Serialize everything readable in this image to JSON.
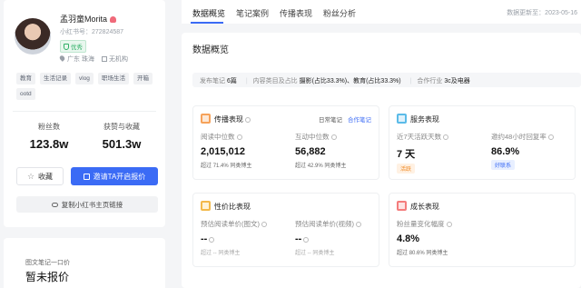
{
  "profile": {
    "name": "孟羽童Morita",
    "id_text": "小红书号：272824587",
    "badge": "优秀",
    "location": "广东 珠海",
    "org": "无机构",
    "tags": [
      "教育",
      "生活记录",
      "vlog",
      "职场生活",
      "开箱",
      "ootd"
    ],
    "stats": [
      {
        "label": "粉丝数",
        "value": "123.8w"
      },
      {
        "label": "获赞与收藏",
        "value": "501.3w"
      }
    ],
    "fav_button": "收藏",
    "quote_button": "邀请TA开启报价",
    "copy_button": "复制小红书主页链接"
  },
  "price": {
    "subtitle": "图文笔记一口价",
    "value": "暂未报价"
  },
  "tabs": [
    "数据概览",
    "笔记案例",
    "传播表现",
    "粉丝分析"
  ],
  "update_text": "数据更新至：2023-05-16",
  "overview": {
    "title": "数据概览",
    "info": {
      "posts_label": "发布笔记",
      "posts_value": "6篇",
      "category_label": "内容类目及占比",
      "category_value": "摄影(占比33.3%)、教育(占比33.3%)",
      "industry_label": "合作行业",
      "industry_value": "3c及电器"
    },
    "spread": {
      "title": "传播表现",
      "opt_daily": "日常笔记",
      "opt_collab": "合作笔记",
      "read_label": "阅读中位数",
      "read_value": "2,015,012",
      "read_note_prefix": "超过",
      "read_note_pct": "71.4%",
      "read_note_suffix": "同类博主",
      "inter_label": "互动中位数",
      "inter_value": "56,882",
      "inter_note_prefix": "超过",
      "inter_note_pct": "42.9%",
      "inter_note_suffix": "同类博主"
    },
    "service": {
      "title": "服务表现",
      "active_label": "近7天活跃天数",
      "active_value": "7 天",
      "active_pill": "活跃",
      "reply_label": "邀约48小时回复率",
      "reply_value": "86.9%",
      "reply_pill": "好联系"
    },
    "cost": {
      "title": "性价比表现",
      "img_label": "预估阅读单价(图文)",
      "img_value": "--",
      "img_note": "超过 -- 同类博主",
      "video_label": "预估阅读单价(视频)",
      "video_value": "--",
      "video_note": "超过 -- 同类博主"
    },
    "growth": {
      "title": "成长表现",
      "fans_label": "粉丝量变化幅度",
      "fans_value": "4.8%",
      "fans_note_prefix": "超过",
      "fans_note_pct": "80.6%",
      "fans_note_suffix": "同类博主"
    }
  }
}
